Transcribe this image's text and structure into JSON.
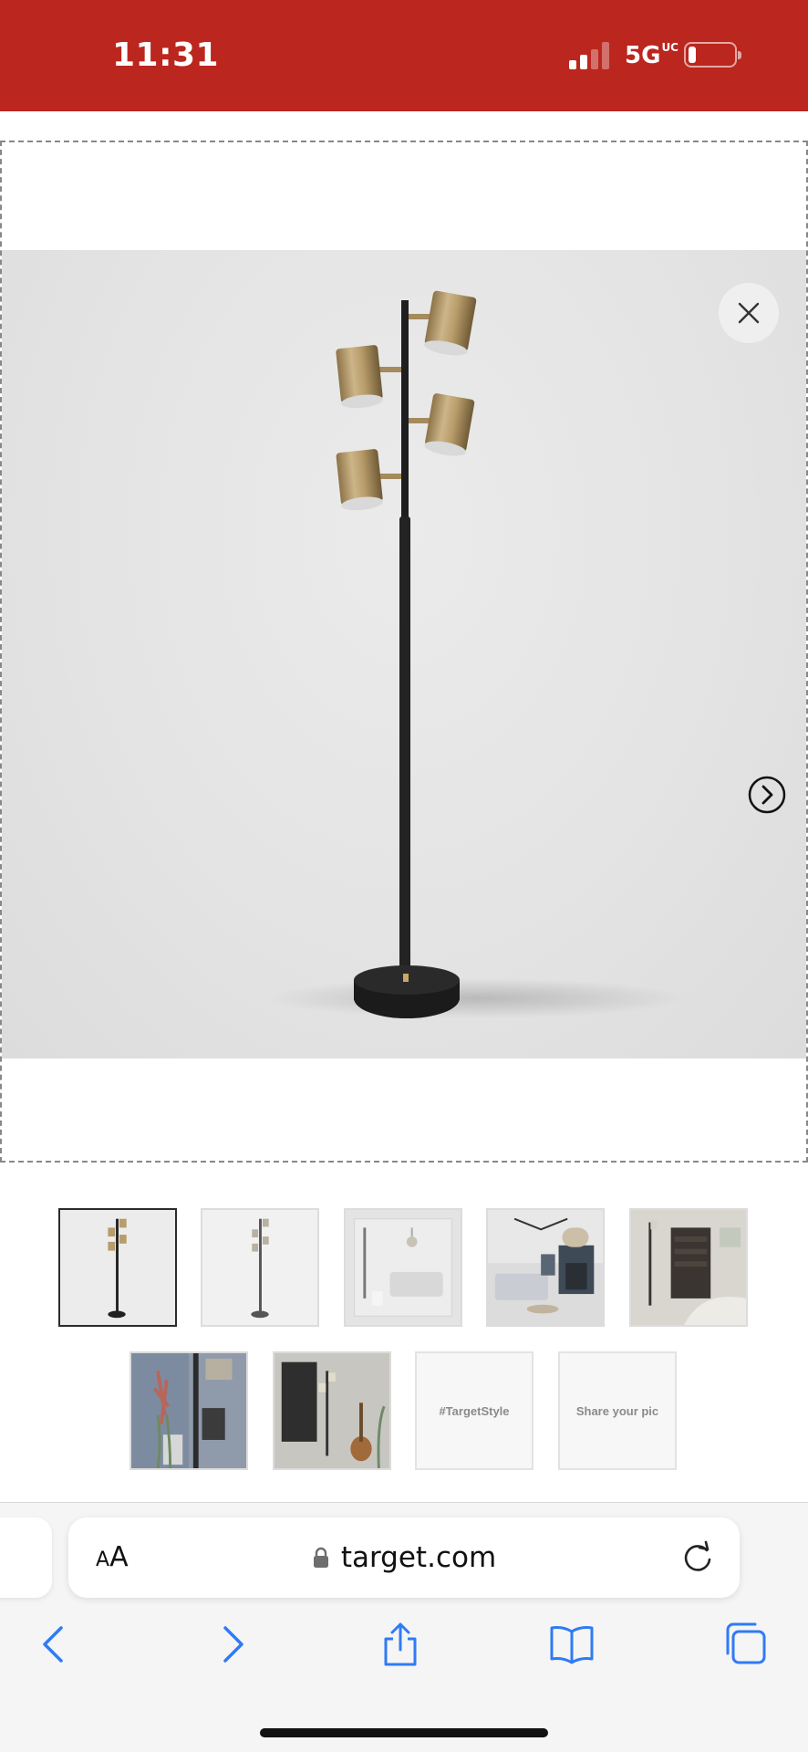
{
  "status_bar": {
    "time": "11:31",
    "network": "5G",
    "network_badge": "UC",
    "signal_bars_active": 2,
    "signal_bars_total": 4,
    "battery_level": 0.15,
    "background_color": "#bb261e"
  },
  "gallery": {
    "close_icon": "close-icon",
    "next_icon": "chevron-right-circle-icon",
    "product_image_subject": "floor-lamp-four-brass-spotlights"
  },
  "thumbnails": [
    {
      "kind": "image",
      "selected": true
    },
    {
      "kind": "image",
      "selected": false
    },
    {
      "kind": "image",
      "selected": false
    },
    {
      "kind": "image",
      "selected": false
    },
    {
      "kind": "image",
      "selected": false
    },
    {
      "kind": "image",
      "selected": false
    },
    {
      "kind": "image",
      "selected": false
    },
    {
      "kind": "text",
      "label": "#TargetStyle",
      "selected": false
    },
    {
      "kind": "text",
      "label": "Share your pic",
      "selected": false
    }
  ],
  "browser": {
    "text_size_small": "A",
    "text_size_large": "A",
    "url": "target.com",
    "reload_icon": "reload-icon",
    "nav": {
      "back_icon": "chevron-left-icon",
      "forward_icon": "chevron-right-icon",
      "share_icon": "share-icon",
      "bookmarks_icon": "book-icon",
      "tabs_icon": "tabs-icon"
    },
    "accent_color": "#2f7bf5"
  }
}
